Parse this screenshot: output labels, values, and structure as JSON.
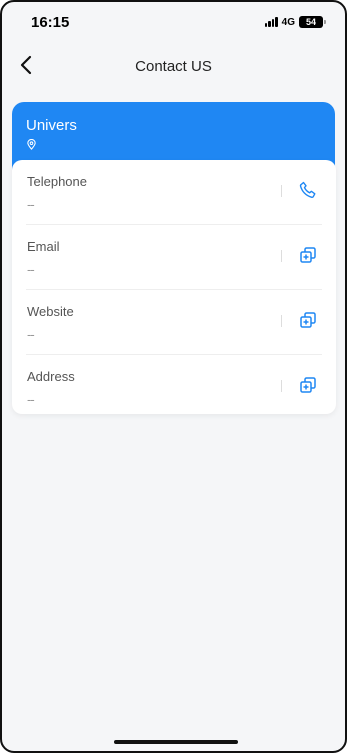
{
  "status_bar": {
    "time": "16:15",
    "network": "4G",
    "battery": "54"
  },
  "nav": {
    "title": "Contact US"
  },
  "company": {
    "name": "Univers"
  },
  "contacts": [
    {
      "label": "Telephone",
      "value": "--",
      "action_icon": "phone-icon"
    },
    {
      "label": "Email",
      "value": "--",
      "action_icon": "copy-icon"
    },
    {
      "label": "Website",
      "value": "--",
      "action_icon": "copy-icon"
    },
    {
      "label": "Address",
      "value": "--",
      "action_icon": "copy-icon"
    }
  ],
  "colors": {
    "accent": "#1f87f3",
    "background": "#f5f6f8"
  }
}
